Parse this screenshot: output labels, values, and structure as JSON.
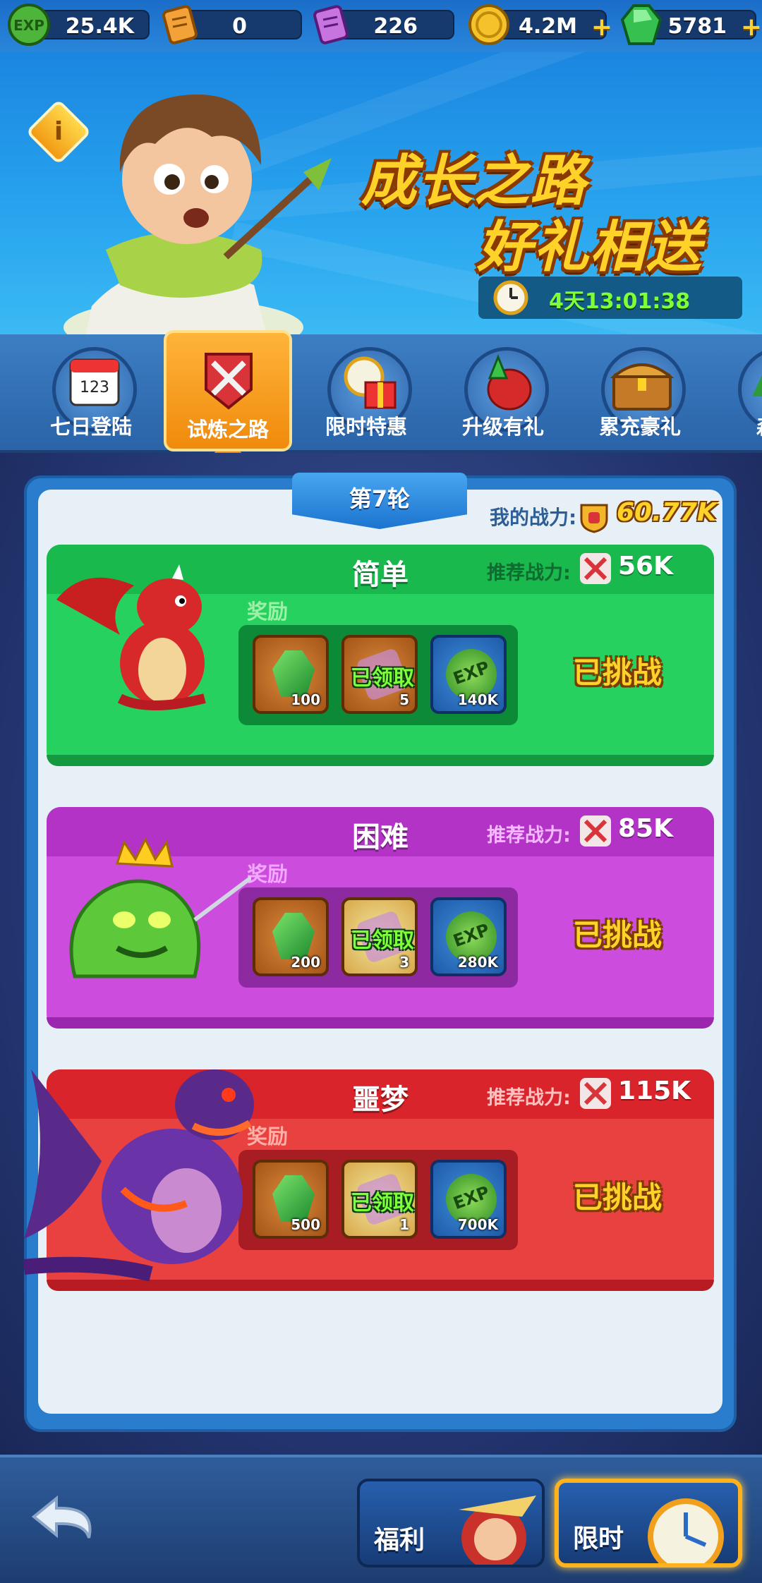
{
  "resources": [
    {
      "icon": "exp-orb-icon",
      "value": "25.4K"
    },
    {
      "icon": "orange-scroll-icon",
      "value": "0"
    },
    {
      "icon": "purple-scroll-icon",
      "value": "226"
    },
    {
      "icon": "gold-coin-icon",
      "value": "4.2M"
    },
    {
      "icon": "green-gem-icon",
      "value": "5781"
    }
  ],
  "banner": {
    "info_icon": "i",
    "title_line1": "成长之路",
    "title_line2": "好礼相送",
    "timer": "4天13:01:38"
  },
  "tabs": [
    {
      "label": "七日登陆",
      "icon": "calendar-icon",
      "active": false
    },
    {
      "label": "试炼之路",
      "icon": "crossed-swords-icon",
      "active": true
    },
    {
      "label": "限时特惠",
      "icon": "alarm-gift-icon",
      "active": false
    },
    {
      "label": "升级有礼",
      "icon": "level-up-bag-icon",
      "active": false
    },
    {
      "label": "累充豪礼",
      "icon": "treasure-chest-icon",
      "active": false
    },
    {
      "label": "森林",
      "icon": "forest-icon",
      "active": false
    }
  ],
  "round": {
    "label": "第7轮"
  },
  "my_power": {
    "label": "我的战力:",
    "value": "60.77K"
  },
  "cards": [
    {
      "title": "简单",
      "rec_label": "推荐战力:",
      "rec_value": "56K",
      "reward_label": "奖励",
      "items": [
        {
          "type": "gem",
          "count": "100",
          "claimed_text": ""
        },
        {
          "type": "scroll",
          "count": "5",
          "claimed_text": "已领取"
        },
        {
          "type": "exp",
          "count": "140K",
          "claimed_text": ""
        }
      ],
      "status": "已挑战",
      "colors": {
        "head": "#19b94e",
        "body": "#27d160",
        "bottom": "#139a3f",
        "rec": "#0f6b2f",
        "box": "#0d8a37",
        "reward": "#9ef0a8"
      }
    },
    {
      "title": "困难",
      "rec_label": "推荐战力:",
      "rec_value": "85K",
      "reward_label": "奖励",
      "items": [
        {
          "type": "gem",
          "count": "200",
          "claimed_text": ""
        },
        {
          "type": "scroll",
          "count": "3",
          "claimed_text": "已领取"
        },
        {
          "type": "exp",
          "count": "280K",
          "claimed_text": ""
        }
      ],
      "status": "已挑战",
      "colors": {
        "head": "#b233c5",
        "body": "#cc4ddd",
        "bottom": "#9a27ad",
        "rec": "#f4b8ff",
        "box": "#8e2aa1",
        "reward": "#f2a8ff"
      }
    },
    {
      "title": "噩梦",
      "rec_label": "推荐战力:",
      "rec_value": "115K",
      "reward_label": "奖励",
      "items": [
        {
          "type": "gem",
          "count": "500",
          "claimed_text": ""
        },
        {
          "type": "scroll",
          "count": "1",
          "claimed_text": "已领取"
        },
        {
          "type": "exp",
          "count": "700K",
          "claimed_text": ""
        }
      ],
      "status": "已挑战",
      "colors": {
        "head": "#d8242a",
        "body": "#e94040",
        "bottom": "#b81b22",
        "rec": "#ffc0c0",
        "box": "#a81d24",
        "reward": "#ffb0a8"
      }
    }
  ],
  "bottom": {
    "back_icon": "back-arrow-icon",
    "welfare_label": "福利",
    "limited_label": "限时"
  }
}
